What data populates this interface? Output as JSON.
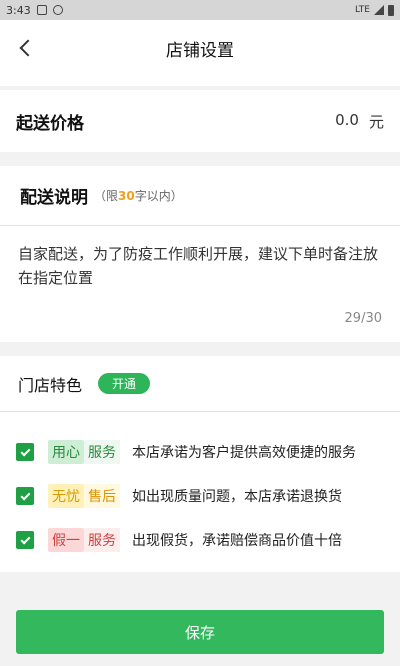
{
  "status_bar": {
    "time": "3:43",
    "network": "LTE"
  },
  "header": {
    "title": "店铺设置"
  },
  "price": {
    "label": "起送价格",
    "value": "0.0",
    "unit": "元"
  },
  "description": {
    "title": "配送说明",
    "hint_prefix": "（限",
    "hint_num": "30",
    "hint_suffix": "字以内）",
    "text": "自家配送，为了防疫工作顺利开展，建议下单时备注放在指定位置",
    "count": "29/30"
  },
  "features": {
    "title": "门店特色",
    "badge": "开通",
    "items": [
      {
        "tag_a": "用心",
        "tag_b": "服务",
        "desc": "本店承诺为客户提供高效便捷的服务",
        "checked": true
      },
      {
        "tag_a": "无忧",
        "tag_b": "售后",
        "desc": "如出现质量问题，本店承诺退换货",
        "checked": true
      },
      {
        "tag_a": "假一",
        "tag_b": "服务",
        "desc": "出现假货，承诺赔偿商品价值十倍",
        "checked": true
      }
    ]
  },
  "save_label": "保存",
  "colors": {
    "accent": "#34b85e",
    "warning": "#f0a020"
  }
}
